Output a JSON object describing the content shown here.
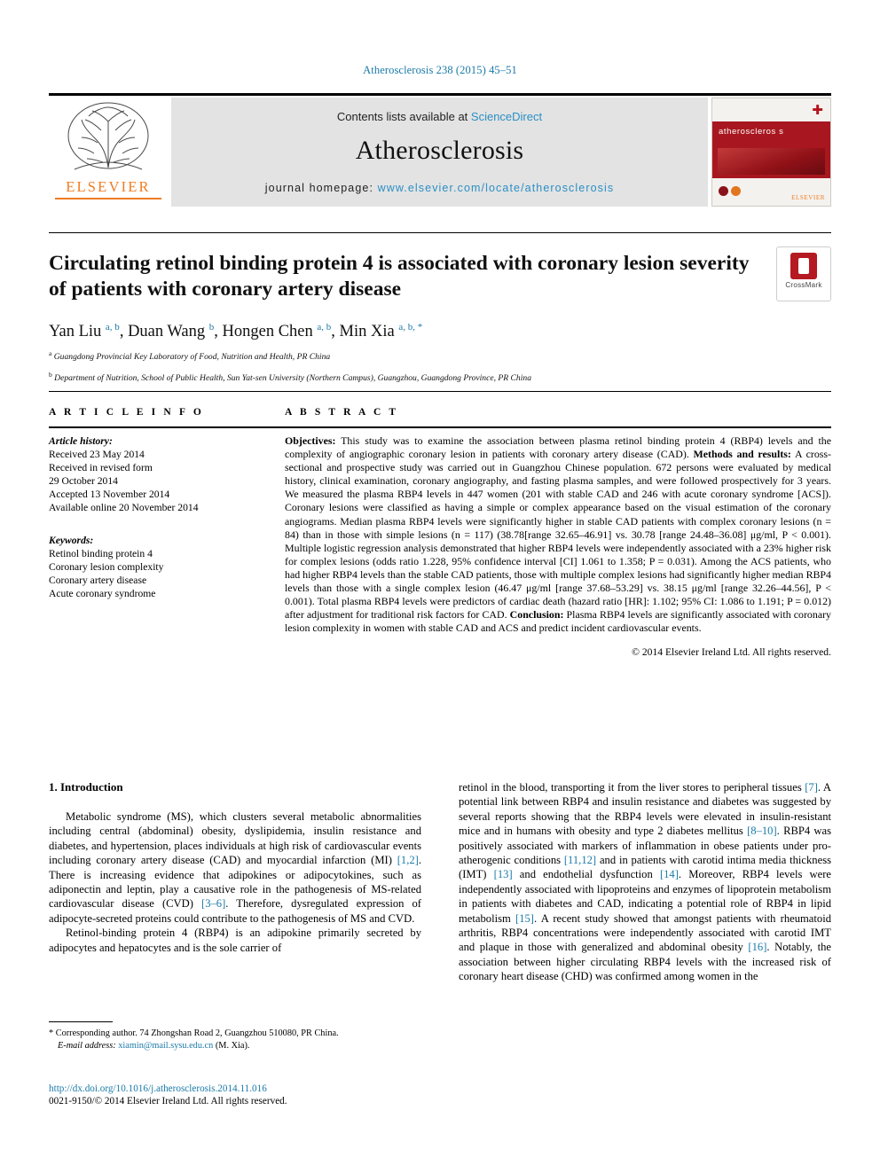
{
  "running_head": "Atherosclerosis 238 (2015) 45–51",
  "masthead": {
    "contents_prefix": "Contents lists available at ",
    "contents_link": "ScienceDirect",
    "journal_name": "Atherosclerosis",
    "homepage_prefix": "journal homepage: ",
    "homepage_url": "www.elsevier.com/locate/atherosclerosis",
    "publisher_logo_word": "ELSEVIER",
    "cover_title": "atheroscleros s"
  },
  "article": {
    "title": "Circulating retinol binding protein 4 is associated with coronary lesion severity of patients with coronary artery disease",
    "crossmark_label": "CrossMark",
    "authors_html": "Yan Liu <sup>a, b</sup>, Duan Wang <sup>b</sup>, Hongen Chen <sup>a, b</sup>, Min Xia <sup>a, b, *</sup>",
    "affiliations": [
      {
        "marker": "a",
        "text": "Guangdong Provincial Key Laboratory of Food, Nutrition and Health, PR China"
      },
      {
        "marker": "b",
        "text": "Department of Nutrition, School of Public Health, Sun Yat-sen University (Northern Campus), Guangzhou, Guangdong Province, PR China"
      }
    ]
  },
  "article_info": {
    "heading": "A R T I C L E   I N F O",
    "history_label": "Article history:",
    "history": [
      "Received 23 May 2014",
      "Received in revised form",
      "29 October 2014",
      "Accepted 13 November 2014",
      "Available online 20 November 2014"
    ],
    "keywords_label": "Keywords:",
    "keywords": [
      "Retinol binding protein 4",
      "Coronary lesion complexity",
      "Coronary artery disease",
      "Acute coronary syndrome"
    ]
  },
  "abstract": {
    "heading": "A B S T R A C T",
    "objectives_label": "Objectives:",
    "objectives_text": " This study was to examine the association between plasma retinol binding protein 4 (RBP4) levels and the complexity of angiographic coronary lesion in patients with coronary artery disease (CAD). ",
    "methods_label": "Methods and results:",
    "methods_text": " A cross-sectional and prospective study was carried out in Guangzhou Chinese population. 672 persons were evaluated by medical history, clinical examination, coronary angiography, and fasting plasma samples, and were followed prospectively for 3 years. We measured the plasma RBP4 levels in 447 women (201 with stable CAD and 246 with acute coronary syndrome [ACS]). Coronary lesions were classified as having a simple or complex appearance based on the visual estimation of the coronary angiograms. Median plasma RBP4 levels were significantly higher in stable CAD patients with complex coronary lesions (n = 84) than in those with simple lesions (n = 117) (38.78[range 32.65–46.91] vs. 30.78 [range 24.48–36.08] μg/ml, P < 0.001). Multiple logistic regression analysis demonstrated that higher RBP4 levels were independently associated with a 23% higher risk for complex lesions (odds ratio 1.228, 95% confidence interval [CI] 1.061 to 1.358; P = 0.031). Among the ACS patients, who had higher RBP4 levels than the stable CAD patients, those with multiple complex lesions had significantly higher median RBP4 levels than those with a single complex lesion (46.47 μg/ml [range 37.68–53.29] vs. 38.15 μg/ml [range 32.26–44.56], P < 0.001). Total plasma RBP4 levels were predictors of cardiac death (hazard ratio [HR]: 1.102; 95% CI: 1.086 to 1.191; P = 0.012) after adjustment for traditional risk factors for CAD. ",
    "conclusion_label": "Conclusion:",
    "conclusion_text": " Plasma RBP4 levels are significantly associated with coronary lesion complexity in women with stable CAD and ACS and predict incident cardiovascular events.",
    "copyright": "© 2014 Elsevier Ireland Ltd. All rights reserved."
  },
  "body": {
    "section_heading": "1. Introduction",
    "left_paragraphs": [
      "Metabolic syndrome (MS), which clusters several metabolic abnormalities including central (abdominal) obesity, dyslipidemia, insulin resistance and diabetes, and hypertension, places individuals at high risk of cardiovascular events including coronary artery disease (CAD) and myocardial infarction (MI) [1,2]. There is increasing evidence that adipokines or adipocytokines, such as adiponectin and leptin, play a causative role in the pathogenesis of MS-related cardiovascular disease (CVD) [3–6]. Therefore, dysregulated expression of adipocyte-secreted proteins could contribute to the pathogenesis of MS and CVD.",
      "Retinol-binding protein 4 (RBP4) is an adipokine primarily secreted by adipocytes and hepatocytes and is the sole carrier of"
    ],
    "right_paragraphs": [
      "retinol in the blood, transporting it from the liver stores to peripheral tissues [7]. A potential link between RBP4 and insulin resistance and diabetes was suggested by several reports showing that the RBP4 levels were elevated in insulin-resistant mice and in humans with obesity and type 2 diabetes mellitus [8–10]. RBP4 was positively associated with markers of inflammation in obese patients under pro-atherogenic conditions [11,12] and in patients with carotid intima media thickness (IMT) [13] and endothelial dysfunction [14]. Moreover, RBP4 levels were independently associated with lipoproteins and enzymes of lipoprotein metabolism in patients with diabetes and CAD, indicating a potential role of RBP4 in lipid metabolism [15]. A recent study showed that amongst patients with rheumatoid arthritis, RBP4 concentrations were independently associated with carotid IMT and plaque in those with generalized and abdominal obesity [16]. Notably, the association between higher circulating RBP4 levels with the increased risk of coronary heart disease (CHD) was confirmed among women in the"
    ]
  },
  "footnote": {
    "corresponding": "* Corresponding author. 74 Zhongshan Road 2, Guangzhou 510080, PR China.",
    "email_label": "E-mail address:",
    "email": "xiamin@mail.sysu.edu.cn",
    "email_suffix": " (M. Xia)."
  },
  "footer": {
    "doi": "http://dx.doi.org/10.1016/j.atherosclerosis.2014.11.016",
    "issn_line": "0021-9150/© 2014 Elsevier Ireland Ltd. All rights reserved."
  },
  "colors": {
    "link": "#1a7aa8",
    "elsevier_orange": "#f07c22",
    "cover_red": "#a8171f"
  }
}
